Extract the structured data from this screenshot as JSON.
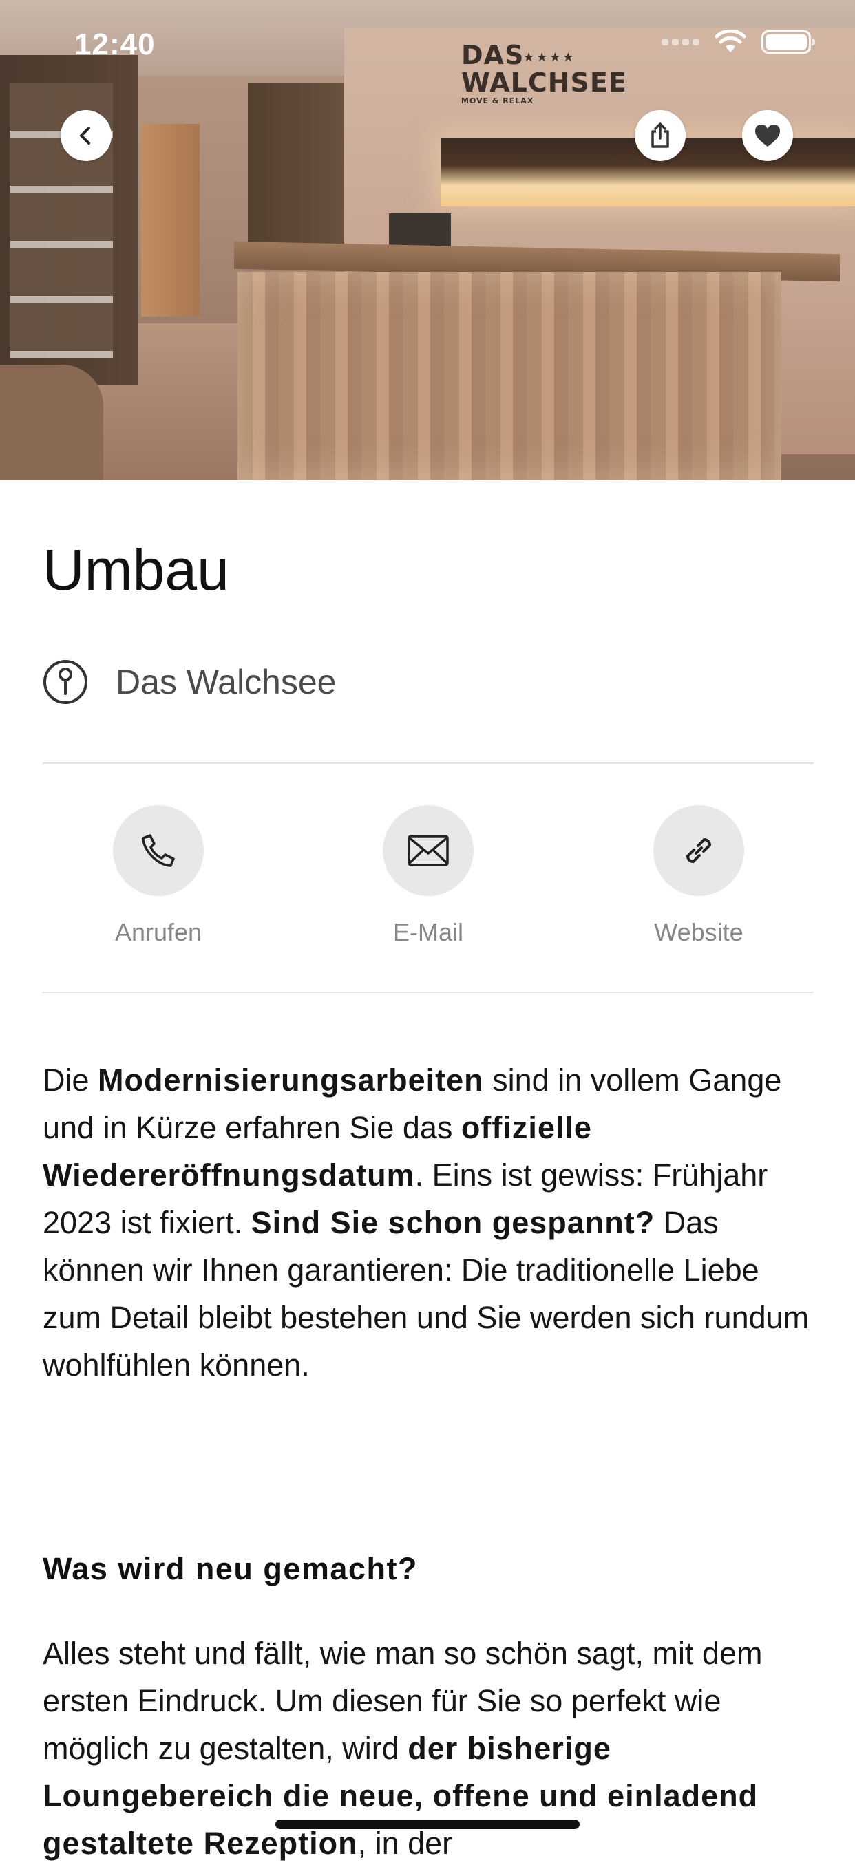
{
  "status_bar": {
    "time": "12:40"
  },
  "hero": {
    "sign_text": "DAS WALCHSEE",
    "sign_stars": "★★★★",
    "sign_sub": "MOVE & RELAX"
  },
  "page": {
    "title": "Umbau",
    "location": "Das Walchsee"
  },
  "actions": [
    {
      "label": "Anrufen",
      "icon": "phone-icon"
    },
    {
      "label": "E-Mail",
      "icon": "mail-icon"
    },
    {
      "label": "Website",
      "icon": "link-icon"
    }
  ],
  "body": {
    "p1": [
      {
        "t": "Die ",
        "b": false
      },
      {
        "t": "Modernisierungsarbeiten",
        "b": true
      },
      {
        "t": " sind in vollem Gange und in Kürze erfahren Sie das ",
        "b": false
      },
      {
        "t": "offizielle Wiedereröffnungsdatum",
        "b": true
      },
      {
        "t": ". Eins ist gewiss: Frühjahr 2023 ist fixiert. ",
        "b": false
      },
      {
        "t": "Sind Sie schon gespannt?",
        "b": true
      },
      {
        "t": " Das können wir Ihnen garantieren: Die traditionelle Liebe zum Detail bleibt bestehen und Sie werden sich rundum wohlfühlen können.",
        "b": false
      }
    ],
    "heading": "Was wird neu gemacht?",
    "p2": [
      {
        "t": "Alles steht und fällt, wie man so schön sagt, mit dem ersten Eindruck. Um diesen für Sie so perfekt wie möglich zu gestalten, wird ",
        "b": false
      },
      {
        "t": "der bisherige Loungebereich die neue, offene und einladend gestaltete Rezeption",
        "b": true
      },
      {
        "t": ", in der",
        "b": false
      }
    ]
  },
  "colors": {
    "action_circle": "#e8e8e8",
    "action_label": "#888888",
    "divider": "#e3e3e3"
  }
}
